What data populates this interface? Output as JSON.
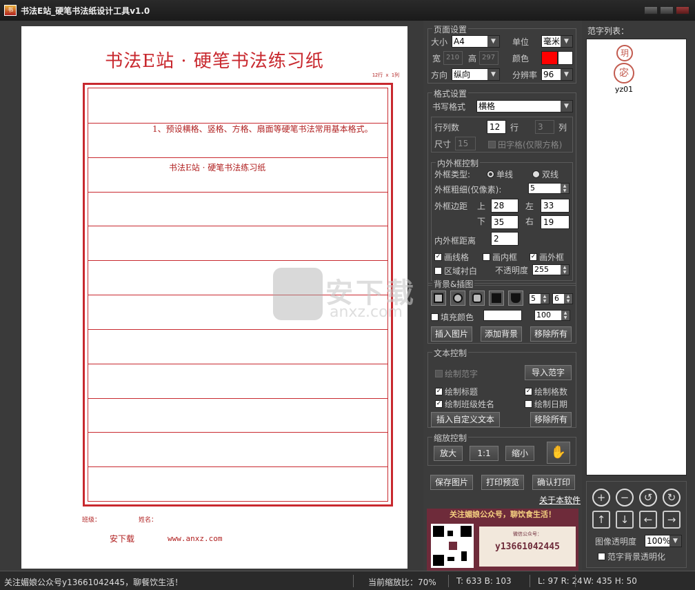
{
  "window": {
    "title": "书法E站_硬笔书法纸设计工具v1.0"
  },
  "paper": {
    "title": "书法E站 · 硬笔书法练习纸",
    "grid_count": "12行 x 1列",
    "line1": "1、预设横格、竖格、方格、扇面等硬笔书法常用基本格式。",
    "line2": "书法E站 · 硬笔书法练习纸",
    "class_label": "班级：",
    "name_label": "姓名：",
    "site_name": "安下载",
    "site_url": "www.anxz.com"
  },
  "page_settings": {
    "title": "页面设置",
    "size_label": "大小",
    "size_value": "A4",
    "unit_label": "单位",
    "unit_value": "毫米",
    "width_label": "宽",
    "width_value": "210",
    "height_label": "高",
    "height_value": "297",
    "color_label": "颜色",
    "color_value": "#ff0000",
    "orient_label": "方向",
    "orient_value": "纵向",
    "dpi_label": "分辨率",
    "dpi_value": "96"
  },
  "format_settings": {
    "title": "格式设置",
    "style_label": "书写格式",
    "style_value": "横格",
    "rowcol_label": "行列数",
    "rows_value": "12",
    "row_unit": "行",
    "cols_value": "3",
    "col_unit": "列",
    "size_label": "尺寸",
    "size_value": "15",
    "tianzi_label": "田字格(仅限方格)"
  },
  "frame_control": {
    "title": "内外框控制",
    "type_label": "外框类型:",
    "single": "单线",
    "double": "双线",
    "thickness_label": "外框粗细(仅像素):",
    "thickness_value": "5",
    "margin_label": "外框边距",
    "top_label": "上",
    "top_value": "28",
    "left_label": "左",
    "left_value": "33",
    "bottom_label": "下",
    "bottom_value": "35",
    "right_label": "右",
    "right_value": "19",
    "gap_label": "内外框距离",
    "gap_value": "2",
    "draw_lines": "画线格",
    "draw_inner": "画内框",
    "draw_outer": "画外框",
    "area_bg": "区域衬白",
    "opacity_label": "不透明度",
    "opacity_value": "255"
  },
  "background": {
    "title": "背景&插图",
    "spin1": "5",
    "spin2": "6",
    "fill_label": "填充颜色",
    "fill_value": "100",
    "insert_image": "插入图片",
    "add_bg": "添加背景",
    "remove_all": "移除所有"
  },
  "text_control": {
    "title": "文本控制",
    "draw_sample": "绘制范字",
    "import_sample": "导入范字",
    "draw_title": "绘制标题",
    "draw_grid_count": "绘制格数",
    "draw_class_name": "绘制班级姓名",
    "draw_date": "绘制日期",
    "insert_custom": "插入自定义文本",
    "remove_all": "移除所有"
  },
  "zoom_control": {
    "title": "缩放控制",
    "zoom_in": "放大",
    "one_to_one": "1:1",
    "zoom_out": "缩小"
  },
  "actions": {
    "save_image": "保存图片",
    "print_preview": "打印预览",
    "confirm_print": "确认打印",
    "about": "关于本软件"
  },
  "ad": {
    "headline": "关注媚娘公众号，聊饮食生活！",
    "wechat_label": "微信公众号：",
    "wechat_id": "y13661042445"
  },
  "samples": {
    "title": "范字列表：",
    "items": [
      {
        "name": "yz01",
        "char1": "玥",
        "char2": "宓"
      }
    ]
  },
  "tools": {
    "opacity_label": "图像透明度",
    "opacity_value": "100%",
    "bg_transparent": "范字背景透明化"
  },
  "status": {
    "message": "关注媚娘公众号y13661042445，聊餐饮生活！",
    "zoom": "当前缩放比：70%",
    "tb": "T: 633 B: 103",
    "lr": "L: 97 R: 24",
    "wh": "W: 435 H: 50"
  }
}
